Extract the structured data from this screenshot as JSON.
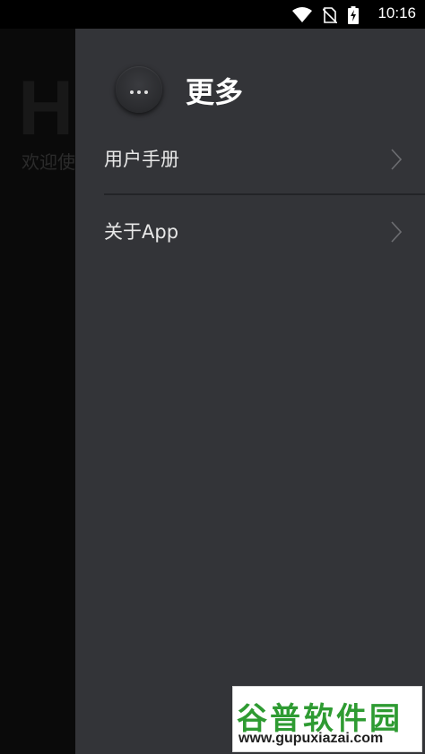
{
  "status_bar": {
    "time": "10:16",
    "icons": [
      "wifi-icon",
      "no-sim-icon",
      "battery-charging-icon"
    ]
  },
  "background_page": {
    "title": "H",
    "subtitle": "欢迎使"
  },
  "drawer": {
    "title": "更多",
    "menu_icon": "more-dots-icon",
    "items": [
      {
        "label": "用户手册",
        "icon": "chevron-right-icon"
      },
      {
        "label": "关于App",
        "icon": "chevron-right-icon"
      }
    ]
  },
  "watermark": {
    "brand": "谷普软件园",
    "url": "www.gupuxiazai.com"
  },
  "colors": {
    "drawer_bg": "#333438",
    "page_bg": "#0b0b0b",
    "text": "#e8e8e8",
    "watermark_green": "#2e9b32"
  }
}
